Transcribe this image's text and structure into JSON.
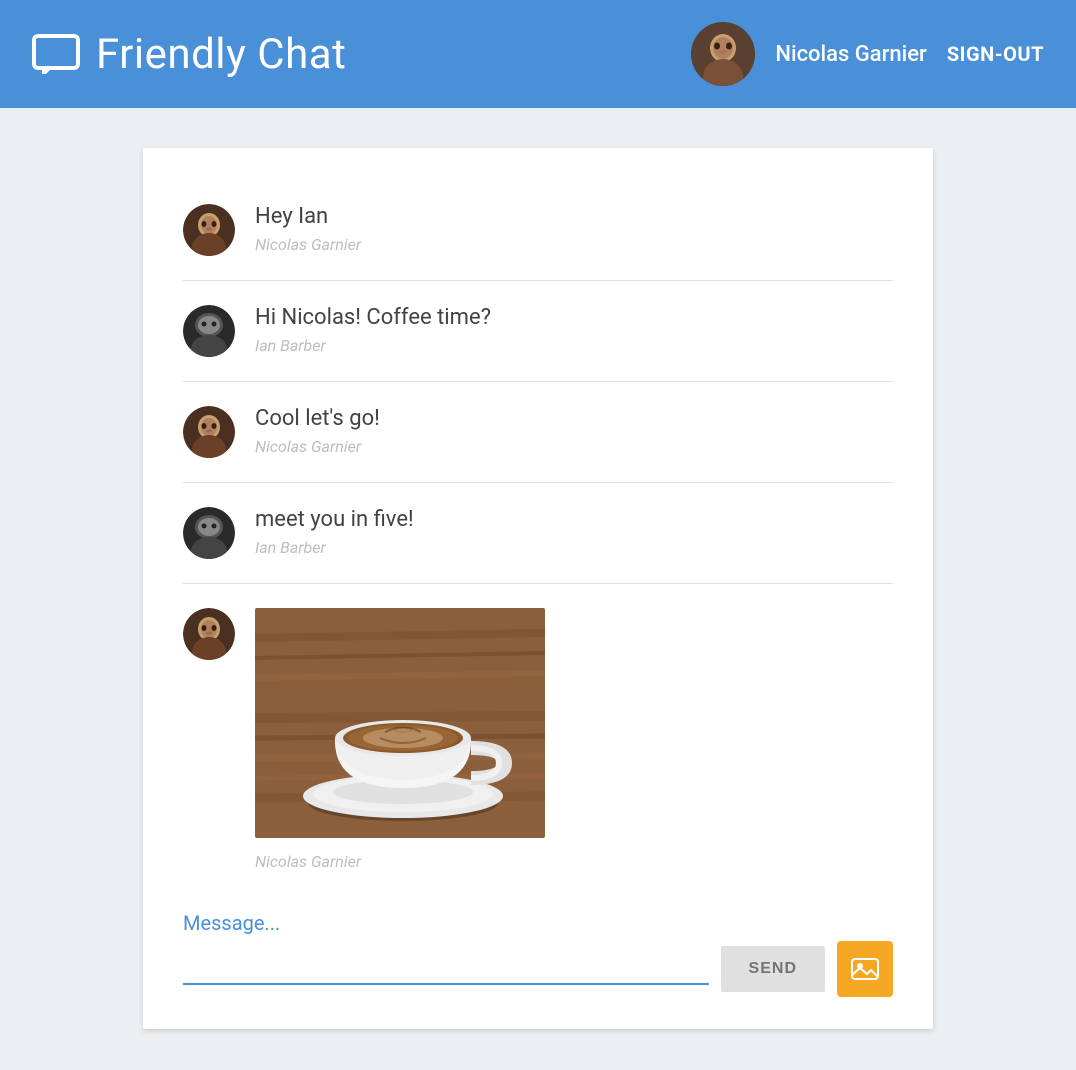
{
  "header": {
    "title": "Friendly Chat",
    "username": "Nicolas Garnier",
    "signout_label": "SIGN-OUT"
  },
  "messages": [
    {
      "id": 1,
      "text": "Hey Ian",
      "author": "Nicolas Garnier",
      "avatar_type": "nicolas",
      "type": "text"
    },
    {
      "id": 2,
      "text": "Hi Nicolas! Coffee time?",
      "author": "Ian Barber",
      "avatar_type": "ian",
      "type": "text"
    },
    {
      "id": 3,
      "text": "Cool let's go!",
      "author": "Nicolas Garnier",
      "avatar_type": "nicolas",
      "type": "text"
    },
    {
      "id": 4,
      "text": "meet you in five!",
      "author": "Ian Barber",
      "avatar_type": "ian",
      "type": "text"
    },
    {
      "id": 5,
      "text": "",
      "author": "Nicolas Garnier",
      "avatar_type": "nicolas",
      "type": "image"
    }
  ],
  "input": {
    "label": "Message...",
    "placeholder": "",
    "send_label": "SEND"
  },
  "colors": {
    "header_bg": "#4a90d9",
    "accent": "#4a90d9",
    "send_bg": "#e0e0e0",
    "image_btn_bg": "#f5a623"
  }
}
